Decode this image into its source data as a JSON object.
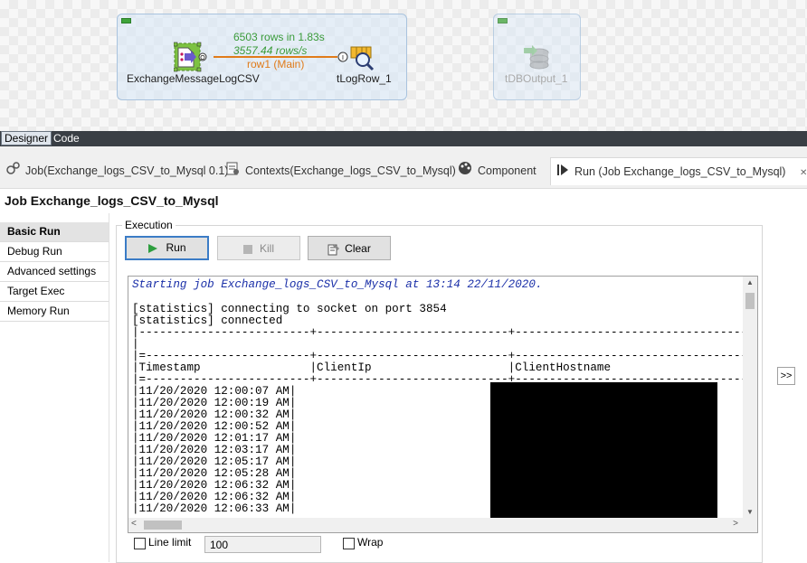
{
  "canvas": {
    "components": {
      "source_label": "ExchangeMessageLogCSV",
      "log_label": "tLogRow_1",
      "db_label": "tDBOutput_1"
    },
    "stats": {
      "rows": "6503 rows in 1.83s",
      "rate": "3557.44 rows/s",
      "link": "row1 (Main)"
    }
  },
  "designer_tabs": [
    "Designer",
    "Code"
  ],
  "view_tabs": [
    {
      "label": "Job(Exchange_logs_CSV_to_Mysql 0.1)"
    },
    {
      "label": "Contexts(Exchange_logs_CSV_to_Mysql)"
    },
    {
      "label": "Component"
    },
    {
      "label": "Run (Job Exchange_logs_CSV_to_Mysql)"
    }
  ],
  "close_glyph": "✕",
  "job_title": "Job Exchange_logs_CSV_to_Mysql",
  "left_nav": [
    "Basic Run",
    "Debug Run",
    "Advanced settings",
    "Target Exec",
    "Memory Run"
  ],
  "execution": {
    "legend": "Execution",
    "run_label": "Run",
    "kill_label": "Kill",
    "clear_label": "Clear"
  },
  "console": {
    "start_line": "Starting job Exchange_logs_CSV_to_Mysql at 13:14 22/11/2020.",
    "stat_lines": [
      "[statistics] connecting to socket on port 3854",
      "[statistics] connected"
    ],
    "table_lines": [
      "|-------------------------+----------------------------+----------------------------------+-----",
      "|",
      "|=------------------------+----------------------------+----------------------------------+-----",
      "|Timestamp                |ClientIp                    |ClientHostname                    |Ser",
      "|=------------------------+----------------------------+----------------------------------+-----"
    ],
    "rows": [
      "|11/20/2020 12:00:07 AM|",
      "|11/20/2020 12:00:19 AM|",
      "|11/20/2020 12:00:32 AM|",
      "|11/20/2020 12:00:52 AM|",
      "|11/20/2020 12:01:17 AM|",
      "|11/20/2020 12:03:17 AM|",
      "|11/20/2020 12:05:17 AM|",
      "|11/20/2020 12:05:28 AM|",
      "|11/20/2020 12:06:32 AM|",
      "|11/20/2020 12:06:32 AM|",
      "|11/20/2020 12:06:33 AM|"
    ]
  },
  "options": {
    "line_limit_label": "Line limit",
    "line_limit_value": "100",
    "wrap_label": "Wrap"
  },
  "expand_label": ">>"
}
